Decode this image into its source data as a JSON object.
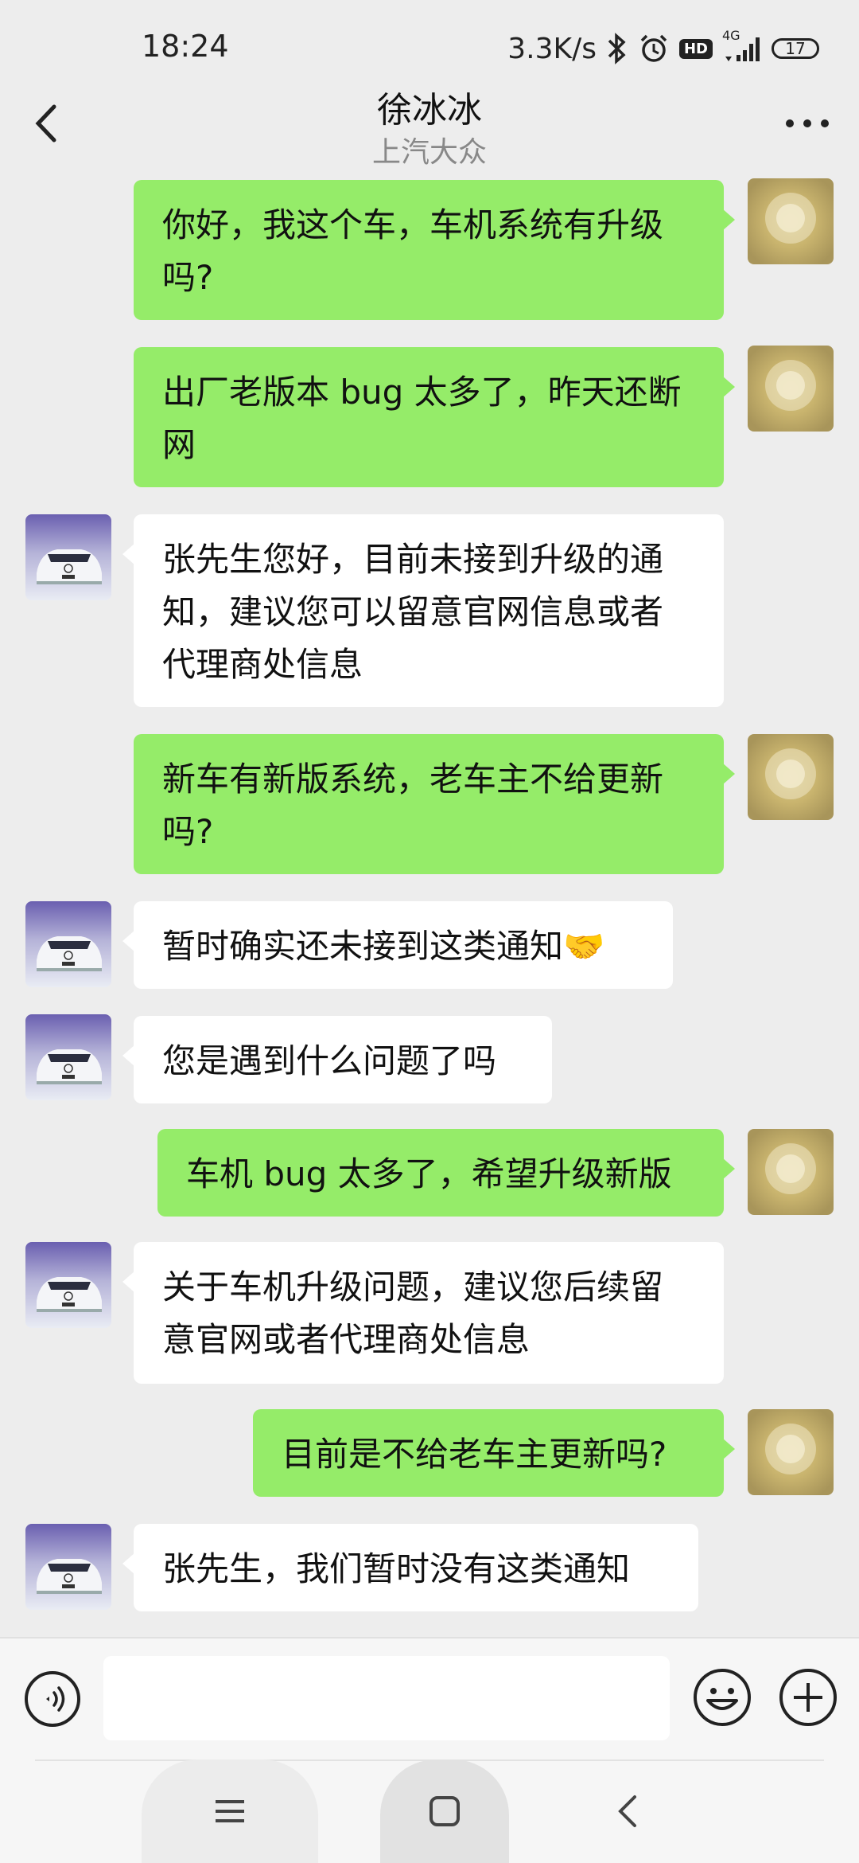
{
  "status_bar": {
    "time": "18:24",
    "net_speed": "3.3K/s",
    "hd_label": "HD",
    "network_type": "4G",
    "battery_level": "17",
    "icons": [
      "bluetooth-icon",
      "alarm-icon",
      "hd-icon",
      "signal-icon",
      "battery-icon"
    ]
  },
  "header": {
    "title": "徐冰冰",
    "subtitle": "上汽大众",
    "back_icon": "chevron-left-icon",
    "more_icon": "more-dots-icon"
  },
  "messages": [
    {
      "from": "me",
      "text": "你好，我这个车，车机系统有升级吗?"
    },
    {
      "from": "me",
      "text": "出厂老版本 bug 太多了，昨天还断网"
    },
    {
      "from": "them",
      "text": "张先生您好，目前未接到升级的通知，建议您可以留意官网信息或者代理商处信息"
    },
    {
      "from": "me",
      "text": "新车有新版系统，老车主不给更新吗?"
    },
    {
      "from": "them",
      "text": "暂时确实还未接到这类通知🤝"
    },
    {
      "from": "them",
      "text": "您是遇到什么问题了吗"
    },
    {
      "from": "me",
      "text": "车机 bug 太多了，希望升级新版"
    },
    {
      "from": "them",
      "text": "关于车机升级问题，建议您后续留意官网或者代理商处信息"
    },
    {
      "from": "me",
      "text": "目前是不给老车主更新吗?"
    },
    {
      "from": "them",
      "text": "张先生，我们暂时没有这类通知"
    }
  ],
  "input_bar": {
    "value": "",
    "icons": [
      "voice-icon",
      "emoji-icon",
      "plus-icon"
    ]
  },
  "nav_bar": {
    "icons": [
      "menu-icon",
      "home-icon",
      "back-icon"
    ]
  },
  "colors": {
    "background": "#ededed",
    "my_bubble": "#95ec69",
    "their_bubble": "#ffffff",
    "subtitle": "#888888"
  }
}
